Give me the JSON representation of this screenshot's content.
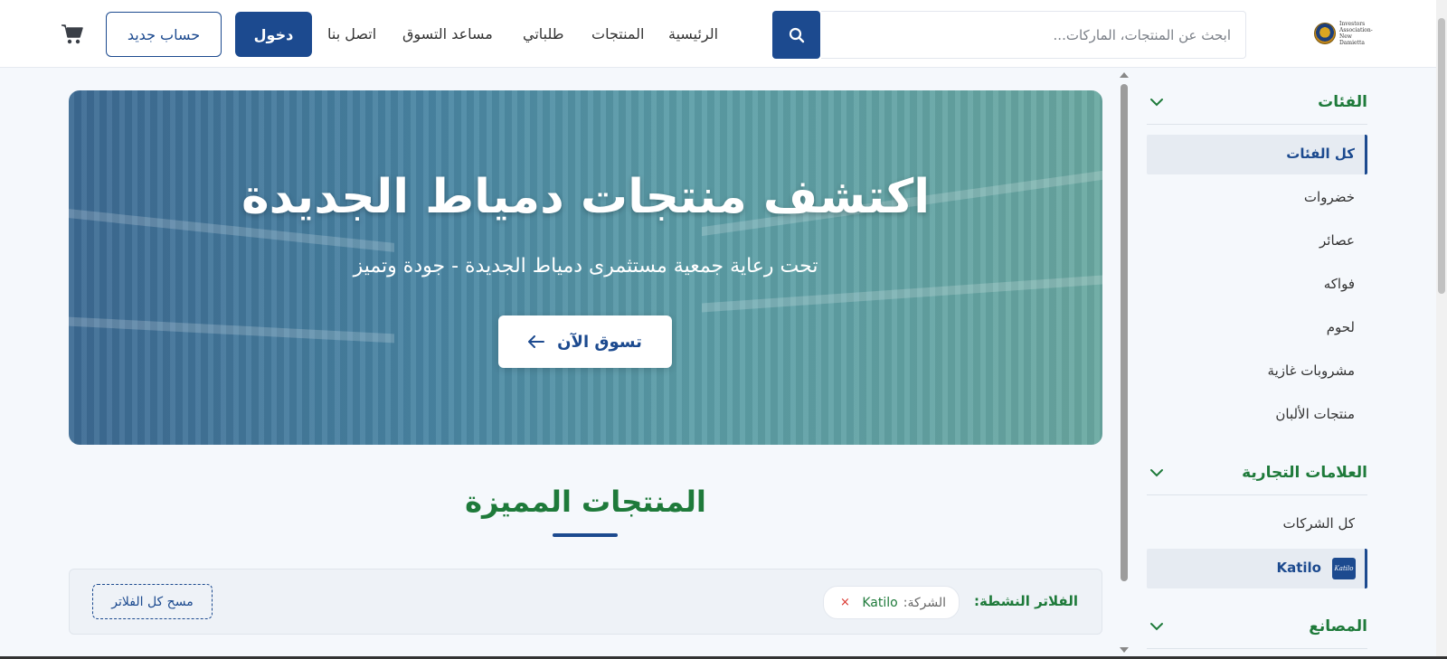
{
  "header": {
    "logo_text": "Investors Association-New Damietta",
    "search_placeholder": "ابحث عن المنتجات، الماركات...",
    "nav": {
      "home": "الرئيسية",
      "products": "المنتجات",
      "orders": "طلباتي",
      "shopping_assistant": "مساعد التسوق",
      "contact": "اتصل بنا"
    },
    "login_label": "دخول",
    "register_label": "حساب جديد"
  },
  "hero": {
    "title": "اكتشف منتجات دمياط الجديدة",
    "subtitle": "تحت رعاية جمعية مستثمرى دمياط الجديدة - جودة وتميز",
    "cta_label": "تسوق الآن"
  },
  "featured": {
    "title": "المنتجات المميزة"
  },
  "filters": {
    "label": "الفلاتر النشطة:",
    "chip_key": "الشركة:",
    "chip_value": "Katilo",
    "chip_remove": "×",
    "clear_label": "مسح كل الفلاتر"
  },
  "sidebar": {
    "categories_title": "الفئات",
    "categories": [
      {
        "label": "كل الفئات",
        "active": true
      },
      {
        "label": "خضروات",
        "active": false
      },
      {
        "label": "عصائر",
        "active": false
      },
      {
        "label": "فواكه",
        "active": false
      },
      {
        "label": "لحوم",
        "active": false
      },
      {
        "label": "مشروبات غازية",
        "active": false
      },
      {
        "label": "منتجات الألبان",
        "active": false
      }
    ],
    "brands_title": "العلامات التجارية",
    "brands": [
      {
        "label": "كل الشركات",
        "active": false
      },
      {
        "label": "Katilo",
        "active": true,
        "logo_text": "Katilo"
      }
    ],
    "factories_title": "المصانع"
  },
  "colors": {
    "primary": "#1c4a8f",
    "accent_green": "#1e7a3a",
    "danger": "#d9322b"
  }
}
